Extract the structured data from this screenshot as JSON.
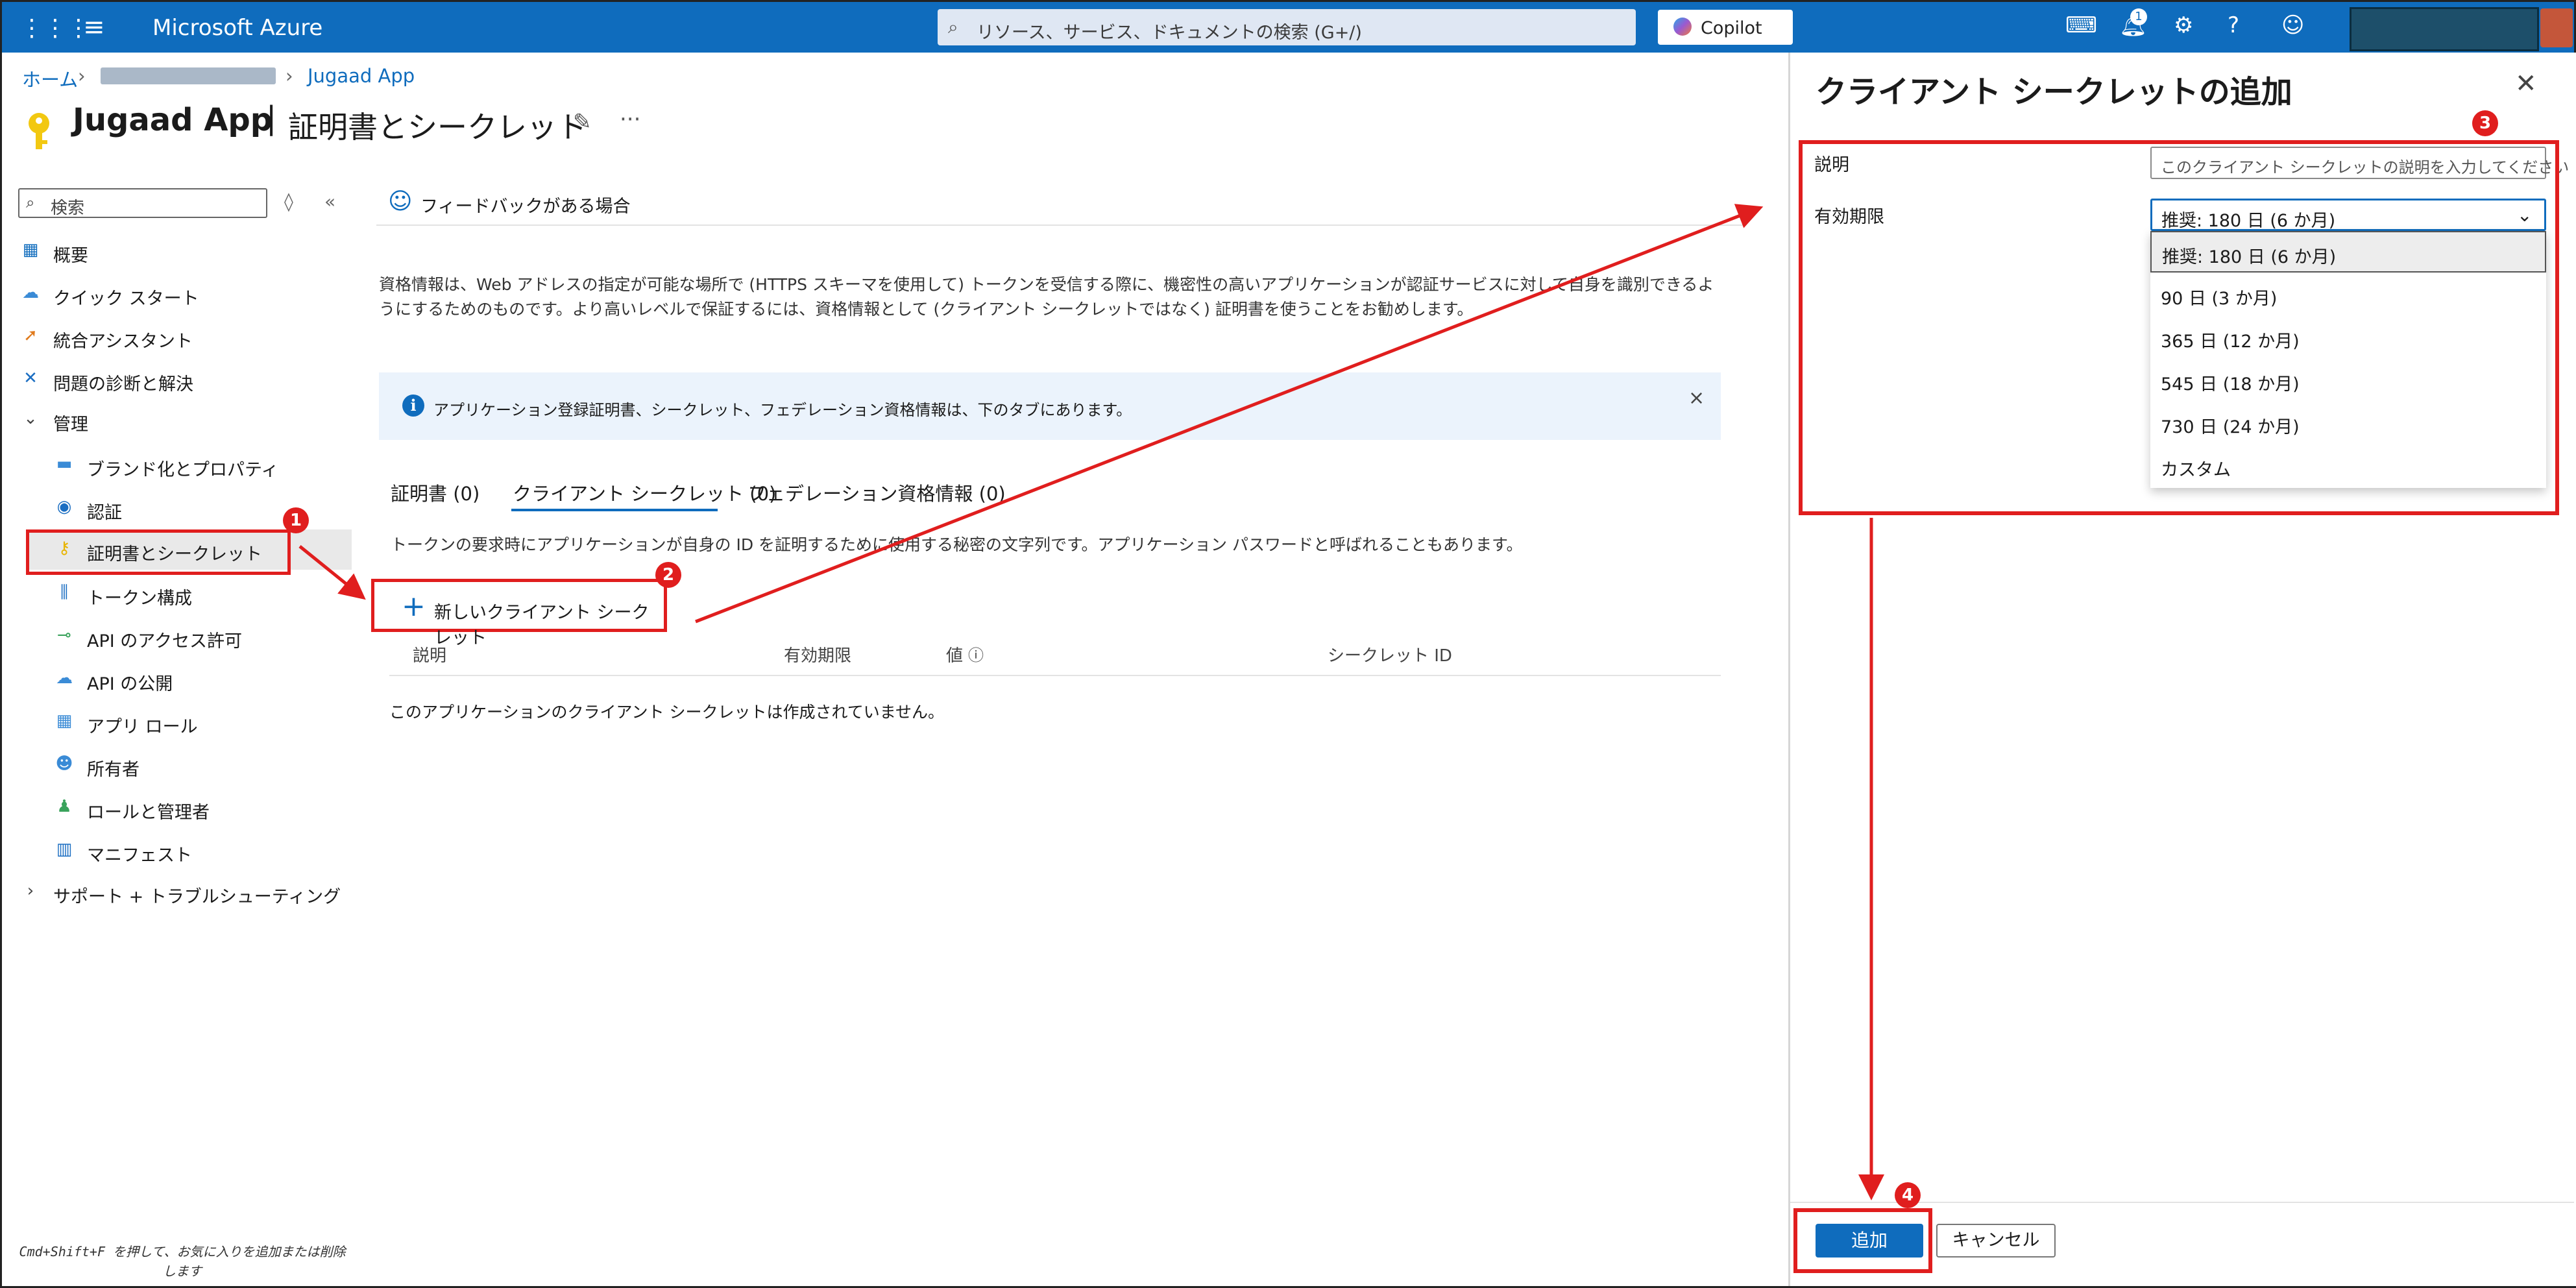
{
  "topbar": {
    "brand": "Microsoft Azure",
    "search_placeholder": "リソース、サービス、ドキュメントの検索 (G+/)",
    "copilot_label": "Copilot",
    "notification_count": "1",
    "icons": [
      "app-grid-icon",
      "hamburger-icon",
      "search-icon",
      "terminal-icon",
      "bell-icon",
      "gear-icon",
      "help-icon",
      "feedback-icon"
    ]
  },
  "breadcrumb": {
    "home": "ホーム",
    "current": "Jugaad App"
  },
  "page": {
    "title": "Jugaad App",
    "subtitle": "証明書とシークレット"
  },
  "sidebar": {
    "search_placeholder": "検索",
    "items": [
      {
        "label": "概要",
        "icon": "overview-icon"
      },
      {
        "label": "クイック スタート",
        "icon": "quickstart-icon"
      },
      {
        "label": "統合アシスタント",
        "icon": "rocket-icon"
      },
      {
        "label": "問題の診断と解決",
        "icon": "wrench-icon"
      },
      {
        "label": "管理",
        "icon": "chevron-down-icon"
      },
      {
        "label": "ブランド化とプロパティ",
        "icon": "branding-icon"
      },
      {
        "label": "認証",
        "icon": "auth-icon"
      },
      {
        "label": "証明書とシークレット",
        "icon": "key-icon"
      },
      {
        "label": "トークン構成",
        "icon": "token-icon"
      },
      {
        "label": "API のアクセス許可",
        "icon": "api-permission-icon"
      },
      {
        "label": "API の公開",
        "icon": "cloud-icon"
      },
      {
        "label": "アプリ ロール",
        "icon": "app-roles-icon"
      },
      {
        "label": "所有者",
        "icon": "owners-icon"
      },
      {
        "label": "ロールと管理者",
        "icon": "roles-admin-icon"
      },
      {
        "label": "マニフェスト",
        "icon": "manifest-icon"
      },
      {
        "label": "サポート + トラブルシューティング",
        "icon": "chevron-right-icon"
      }
    ],
    "keyboard_hint": "Cmd+Shift+F を押して、お気に入りを追加または削除します"
  },
  "main": {
    "feedback_label": "フィードバックがある場合",
    "description": "資格情報は、Web アドレスの指定が可能な場所で (HTTPS スキーマを使用して) トークンを受信する際に、機密性の高いアプリケーションが認証サービスに対して自身を識別できるようにするためのものです。より高いレベルで保証するには、資格情報として (クライアント シークレットではなく) 証明書を使うことをお勧めします。",
    "info_banner": "アプリケーション登録証明書、シークレット、フェデレーション資格情報は、下のタブにあります。",
    "tabs": [
      "証明書 (0)",
      "クライアント シークレット (0)",
      "フェデレーション資格情報 (0)"
    ],
    "tab_help": "トークンの要求時にアプリケーションが自身の ID を証明するために使用する秘密の文字列です。アプリケーション パスワードと呼ばれることもあります。",
    "new_secret_label": "新しいクライアント シークレット",
    "columns": [
      "説明",
      "有効期限",
      "値",
      "シークレット ID"
    ],
    "empty_message": "このアプリケーションのクライアント シークレットは作成されていません。"
  },
  "panel": {
    "title": "クライアント シークレットの追加",
    "description_label": "説明",
    "description_placeholder": "このクライアント シークレットの説明を入力してください",
    "expires_label": "有効期限",
    "expires_value": "推奨: 180 日 (6 か月)",
    "expires_options": [
      "推奨: 180 日 (6 か月)",
      "90 日 (3 か月)",
      "365 日 (12 か月)",
      "545 日 (18 か月)",
      "730 日 (24 か月)",
      "カスタム"
    ],
    "add_label": "追加",
    "cancel_label": "キャンセル"
  },
  "annotations": {
    "steps": [
      "1",
      "2",
      "3",
      "4"
    ],
    "color": "#e01e1e"
  },
  "colors": {
    "azure_blue": "#0f6cbd",
    "annotation_red": "#e01e1e"
  }
}
